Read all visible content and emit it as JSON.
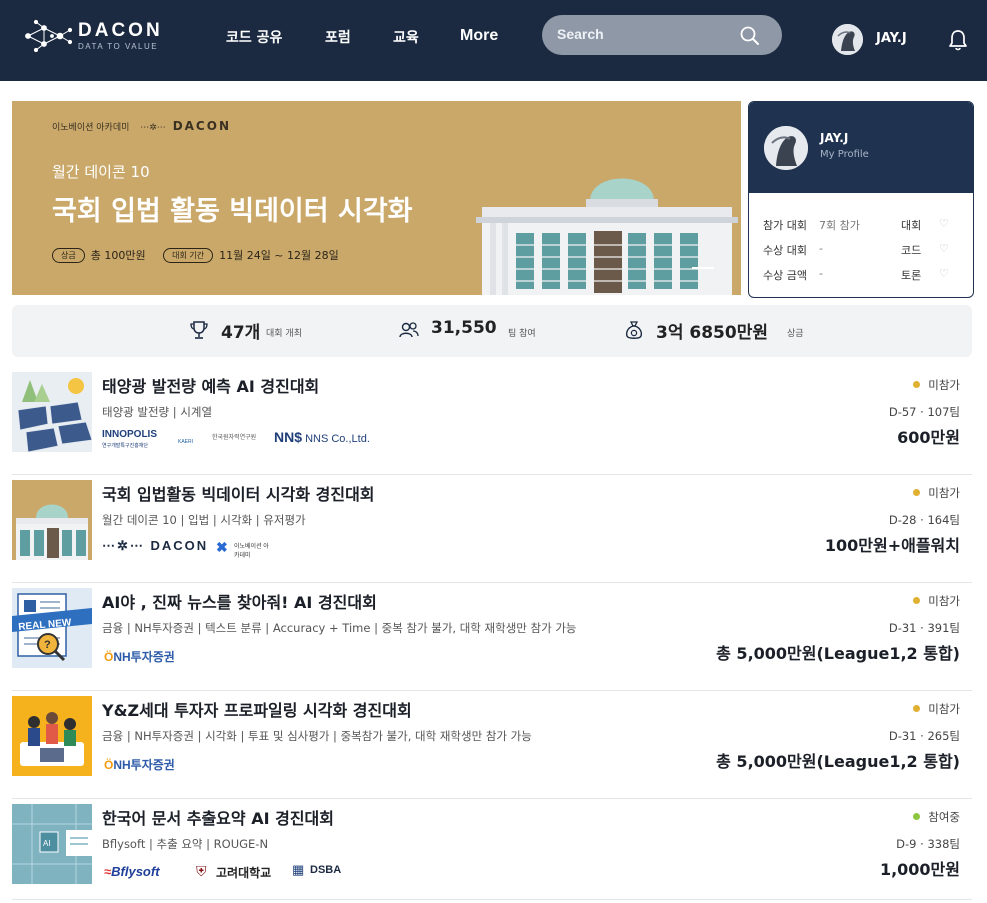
{
  "nav": {
    "brand": "DACON",
    "brand_sub": "DATA TO VALUE",
    "links": [
      "코드 공유",
      "포럼",
      "교육",
      "More"
    ],
    "search_placeholder": "Search",
    "user": "JAY.J"
  },
  "banner": {
    "orgs": "이노베이션 아카데미",
    "orgs_brand": "DACON",
    "subtitle": "월간 데이콘 10",
    "title": "국회 입법 활동 빅데이터 시각화",
    "prize_pill": "상금",
    "prize_text": "총 100만원",
    "period_pill": "대회 기간",
    "period_text": "11월 24일 ~ 12월 28일"
  },
  "profile": {
    "name": "JAY.J",
    "link": "My Profile",
    "rows": [
      {
        "label": "참가 대회",
        "value": "7회 참가",
        "link": "대회"
      },
      {
        "label": "수상 대회",
        "value": "-",
        "link": "코드"
      },
      {
        "label": "수상 금액",
        "value": "-",
        "link": "토론"
      }
    ]
  },
  "stats": [
    {
      "num": "47개",
      "label": "대회 개최",
      "icon": "trophy-icon"
    },
    {
      "num": "31,550",
      "label": "팀 참여",
      "icon": "users-icon"
    },
    {
      "num": "3억 6850만원",
      "label": "상금",
      "icon": "money-bag-icon"
    }
  ],
  "competitions": [
    {
      "title": "태양광 발전량 예측 AI 경진대회",
      "tags": "태양광 발전량 | 시계열",
      "sponsors": [
        "INNOPOLIS",
        "연구개발특구진흥재단",
        "KAERI",
        "한국원자력연구원",
        "NNS Co.,Ltd."
      ],
      "status": "미참가",
      "status_color": "#e0b030",
      "dday": "D-57 · 107팀",
      "prize": "600만원"
    },
    {
      "title": "국회 입법활동 빅데이터 시각화 경진대회",
      "tags": "월간 데이콘 10 | 입법 | 시각화 | 유저평가",
      "sponsors": [
        "DACON",
        "이노베이션 아카데미"
      ],
      "status": "미참가",
      "status_color": "#e0b030",
      "dday": "D-28 · 164팀",
      "prize": "100만원+애플워치"
    },
    {
      "title": "AI야 , 진짜 뉴스를 찾아줘! AI 경진대회",
      "tags": "금융 | NH투자증권 | 텍스트 분류 | Accuracy + Time | 중복 참가 불가, 대학 재학생만 참가 가능",
      "sponsors": [
        "NH투자증권"
      ],
      "status": "미참가",
      "status_color": "#e0b030",
      "dday": "D-31 · 391팀",
      "prize": "총 5,000만원(League1,2 통합)"
    },
    {
      "title": "Y&Z세대 투자자 프로파일링 시각화 경진대회",
      "tags": "금융 | NH투자증권 | 시각화 | 투표 및 심사평가 | 중복참가 불가, 대학 재학생만 참가 가능",
      "sponsors": [
        "NH투자증권"
      ],
      "status": "미참가",
      "status_color": "#e0b030",
      "dday": "D-31 · 265팀",
      "prize": "총 5,000만원(League1,2 통합)"
    },
    {
      "title": "한국어 문서 추출요약 AI 경진대회",
      "tags": "Bflysoft | 추출 요약 | ROUGE-N",
      "sponsors": [
        "Bflysoft",
        "고려대학교",
        "DSBA"
      ],
      "status": "참여중",
      "status_color": "#8cc63f",
      "dday": "D-9 · 338팀",
      "prize": "1,000만원"
    }
  ]
}
